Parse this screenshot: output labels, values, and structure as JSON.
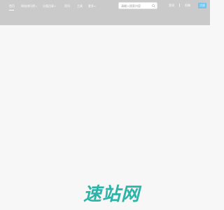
{
  "header": {
    "nav": [
      {
        "label": "首页"
      },
      {
        "label": "网站排行榜",
        "has_dropdown": true
      },
      {
        "label": "分类目录",
        "has_dropdown": true
      },
      {
        "label": "资讯",
        "has_dropdown": false
      },
      {
        "label": "工具"
      },
      {
        "label": "更多",
        "has_dropdown": true
      }
    ],
    "search": {
      "placeholder": "请输入搜索内容",
      "value": ""
    },
    "login_label": "登录",
    "register_label": "注册",
    "extra_label": "投稿"
  },
  "watermark": {
    "text": "速站网"
  },
  "colors": {
    "header_bg": "#cacaca",
    "page_bg": "#f7f7f7",
    "accent": "#6fc3ee",
    "watermark": "#2bb4a9"
  }
}
